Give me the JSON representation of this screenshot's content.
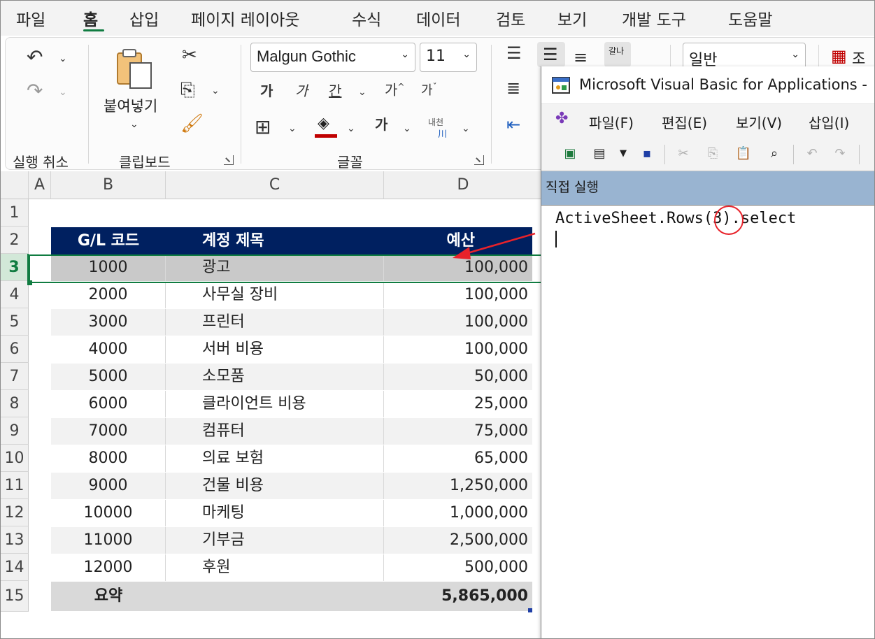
{
  "menu": {
    "tabs": [
      "파일",
      "홈",
      "삽입",
      "페이지 레이아웃",
      "수식",
      "데이터",
      "검토",
      "보기",
      "개발 도구",
      "도움말"
    ],
    "active": "홈"
  },
  "ribbon": {
    "groups": {
      "undo": "실행 취소",
      "clipboard": "클립보드",
      "font": "글꼴"
    },
    "paste_label": "붙여넣기",
    "font_name": "Malgun Gothic",
    "font_size": "11",
    "number_format": "일반",
    "bold_glyph": "가",
    "italic_glyph": "가",
    "underline_glyph": "간",
    "grow_glyph": "가",
    "shrink_glyph": "가",
    "fontcolor_glyph": "가",
    "phonetic_glyph": "내천",
    "wrap_glyph": "갈나",
    "cond_format_glyph": "조"
  },
  "sheet": {
    "columns": [
      "A",
      "B",
      "C",
      "D"
    ],
    "rows": [
      "1",
      "2",
      "3",
      "4",
      "5",
      "6",
      "7",
      "8",
      "9",
      "10",
      "11",
      "12",
      "13",
      "14",
      "15"
    ],
    "selected_row": "3",
    "header": {
      "code": "G/L 코드",
      "title": "계정 제목",
      "budget": "예산"
    },
    "data": [
      {
        "code": "1000",
        "title": "광고",
        "budget": "100,000"
      },
      {
        "code": "2000",
        "title": "사무실 장비",
        "budget": "100,000"
      },
      {
        "code": "3000",
        "title": "프린터",
        "budget": "100,000"
      },
      {
        "code": "4000",
        "title": "서버 비용",
        "budget": "100,000"
      },
      {
        "code": "5000",
        "title": "소모품",
        "budget": "50,000"
      },
      {
        "code": "6000",
        "title": "클라이언트 비용",
        "budget": "25,000"
      },
      {
        "code": "7000",
        "title": "컴퓨터",
        "budget": "75,000"
      },
      {
        "code": "8000",
        "title": "의료 보험",
        "budget": "65,000"
      },
      {
        "code": "9000",
        "title": "건물 비용",
        "budget": "1,250,000"
      },
      {
        "code": "10000",
        "title": "마케팅",
        "budget": "1,000,000"
      },
      {
        "code": "11000",
        "title": "기부금",
        "budget": "2,500,000"
      },
      {
        "code": "12000",
        "title": "후원",
        "budget": "500,000"
      }
    ],
    "total": {
      "label": "요약",
      "value": "5,865,000"
    }
  },
  "vba": {
    "title": "Microsoft Visual Basic for Applications -",
    "menu": [
      "파일(F)",
      "편집(E)",
      "보기(V)",
      "삽입(I)"
    ],
    "immediate_title": "직접 실행",
    "code_line": "ActiveSheet.Rows(3).select"
  },
  "colors": {
    "excel_green": "#107c41",
    "header_navy": "#002060",
    "annotation_red": "#e8222a",
    "immediate_title_bg": "#99b4d1"
  }
}
